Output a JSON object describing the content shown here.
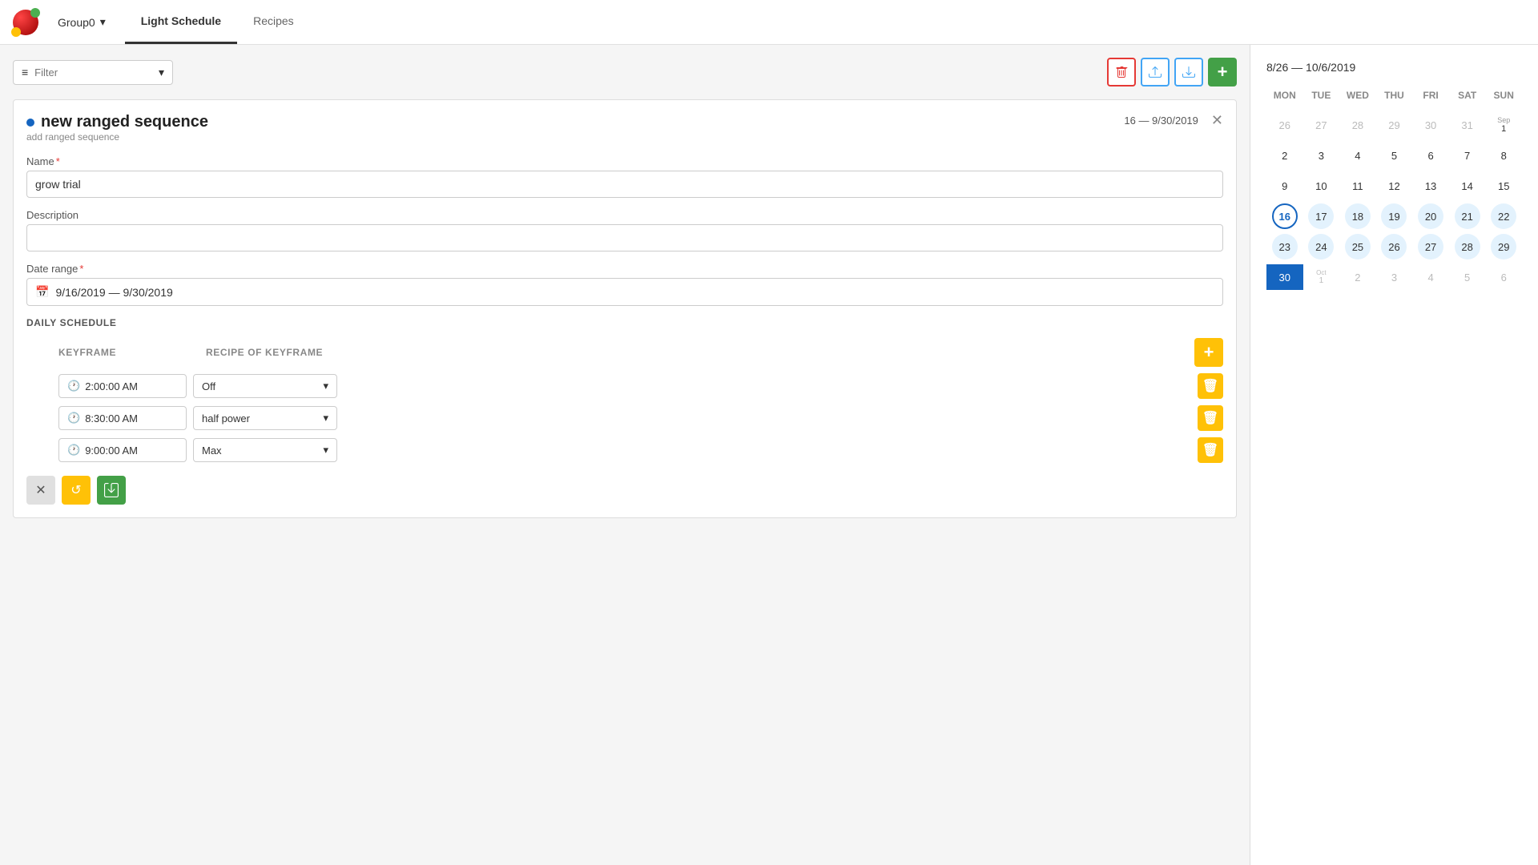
{
  "app": {
    "logo_alt": "App Logo"
  },
  "nav": {
    "group_label": "Group0",
    "tabs": [
      {
        "id": "light-schedule",
        "label": "Light Schedule",
        "active": true
      },
      {
        "id": "recipes",
        "label": "Recipes",
        "active": false
      }
    ]
  },
  "toolbar": {
    "filter_placeholder": "Filter",
    "btn_delete_label": "🗑",
    "btn_upload_label": "↑",
    "btn_download_label": "↓",
    "btn_add_label": "+"
  },
  "form": {
    "title": "new ranged sequence",
    "subtitle": "add ranged sequence",
    "date_badge": "16 — 9/30/2019",
    "name_label": "Name",
    "name_value": "grow trial",
    "description_label": "Description",
    "description_placeholder": "",
    "date_range_label": "Date range",
    "date_range_value": "9/16/2019 — 9/30/2019",
    "daily_schedule_label": "DAILY SCHEDULE",
    "col_keyframe": "KEYFRAME",
    "col_recipe": "RECIPE OF KEYFRAME",
    "keyframes": [
      {
        "time": "2:00:00 AM",
        "recipe": "Off"
      },
      {
        "time": "8:30:00 AM",
        "recipe": "half power"
      },
      {
        "time": "9:00:00 AM",
        "recipe": "Max"
      }
    ],
    "actions": {
      "cancel_label": "✕",
      "reset_label": "↺",
      "save_label": "💾"
    }
  },
  "calendar": {
    "range_label": "8/26 — 10/6/2019",
    "day_names": [
      "MON",
      "TUE",
      "WED",
      "THU",
      "FRI",
      "SAT",
      "SUN"
    ],
    "weeks": [
      [
        {
          "num": "26",
          "month": "prev"
        },
        {
          "num": "27",
          "month": "prev"
        },
        {
          "num": "28",
          "month": "prev"
        },
        {
          "num": "29",
          "month": "prev"
        },
        {
          "num": "30",
          "month": "prev"
        },
        {
          "num": "31",
          "month": "prev"
        },
        {
          "num": "1",
          "month": "sep",
          "label": "Sep 1"
        }
      ],
      [
        {
          "num": "2",
          "month": "sep"
        },
        {
          "num": "3",
          "month": "sep"
        },
        {
          "num": "4",
          "month": "sep"
        },
        {
          "num": "5",
          "month": "sep"
        },
        {
          "num": "6",
          "month": "sep"
        },
        {
          "num": "7",
          "month": "sep"
        },
        {
          "num": "8",
          "month": "sep"
        }
      ],
      [
        {
          "num": "9",
          "month": "sep"
        },
        {
          "num": "10",
          "month": "sep"
        },
        {
          "num": "11",
          "month": "sep"
        },
        {
          "num": "12",
          "month": "sep"
        },
        {
          "num": "13",
          "month": "sep"
        },
        {
          "num": "14",
          "month": "sep"
        },
        {
          "num": "15",
          "month": "sep"
        }
      ],
      [
        {
          "num": "16",
          "month": "sep",
          "today": true
        },
        {
          "num": "17",
          "month": "sep",
          "in_range": true
        },
        {
          "num": "18",
          "month": "sep",
          "in_range": true
        },
        {
          "num": "19",
          "month": "sep",
          "in_range": true
        },
        {
          "num": "20",
          "month": "sep",
          "in_range": true
        },
        {
          "num": "21",
          "month": "sep",
          "in_range": true
        },
        {
          "num": "22",
          "month": "sep",
          "in_range": true
        }
      ],
      [
        {
          "num": "23",
          "month": "sep",
          "in_range": true
        },
        {
          "num": "24",
          "month": "sep",
          "in_range": true
        },
        {
          "num": "25",
          "month": "sep",
          "in_range": true
        },
        {
          "num": "26",
          "month": "sep",
          "in_range": true
        },
        {
          "num": "27",
          "month": "sep",
          "in_range": true
        },
        {
          "num": "28",
          "month": "sep",
          "in_range": true
        },
        {
          "num": "29",
          "month": "sep",
          "in_range": true
        }
      ],
      [
        {
          "num": "30",
          "month": "sep",
          "range_end": true
        },
        {
          "num": "1",
          "month": "oct",
          "oct_label": "Oct\n1"
        },
        {
          "num": "2",
          "month": "oct"
        },
        {
          "num": "3",
          "month": "oct"
        },
        {
          "num": "4",
          "month": "oct"
        },
        {
          "num": "5",
          "month": "oct"
        },
        {
          "num": "6",
          "month": "oct"
        }
      ]
    ]
  },
  "colors": {
    "primary_blue": "#1565c0",
    "green": "#43a047",
    "yellow": "#ffc107",
    "red": "#e53935",
    "light_blue_range": "#e3f2fd"
  }
}
